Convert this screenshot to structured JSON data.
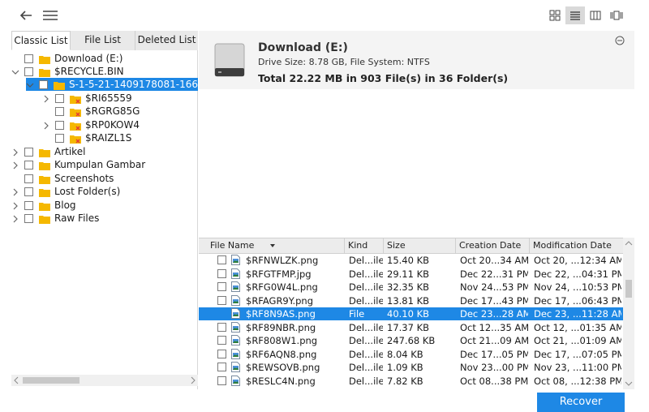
{
  "colors": {
    "accent": "#1e88e5",
    "folder": "#f5b800",
    "mark": "#e53935"
  },
  "tabs": [
    {
      "label": "Classic List"
    },
    {
      "label": "File List"
    },
    {
      "label": "Deleted List"
    }
  ],
  "tree": [
    {
      "label": "Download (E:)",
      "chevron": "",
      "icon": "folder-icon"
    },
    {
      "label": "$RECYCLE.BIN",
      "chevron": "chevron-down-icon",
      "icon": "folder-icon"
    },
    {
      "label": "S-1-5-21-1409178081-166",
      "chevron": "chevron-down-icon",
      "icon": "folder-icon",
      "selected": true
    },
    {
      "label": "$RI65559",
      "chevron": "chevron-right-icon",
      "icon": "folder-x-icon"
    },
    {
      "label": "$RGRG85G",
      "chevron": "",
      "icon": "folder-x-icon"
    },
    {
      "label": "$RP0KOW4",
      "chevron": "chevron-right-icon",
      "icon": "folder-x-icon"
    },
    {
      "label": "$RAIZL1S",
      "chevron": "",
      "icon": "folder-x-icon"
    },
    {
      "label": "Artikel",
      "chevron": "chevron-right-icon",
      "icon": "folder-icon"
    },
    {
      "label": "Kumpulan Gambar",
      "chevron": "chevron-right-icon",
      "icon": "folder-icon"
    },
    {
      "label": "Screenshots",
      "chevron": "",
      "icon": "folder-icon"
    },
    {
      "label": "Lost Folder(s)",
      "chevron": "chevron-right-icon",
      "icon": "folder-icon"
    },
    {
      "label": "Blog",
      "chevron": "chevron-right-icon",
      "icon": "folder-icon"
    },
    {
      "label": "Raw Files",
      "chevron": "chevron-right-icon",
      "icon": "folder-icon"
    }
  ],
  "header": {
    "title": "Download (E:)",
    "info": "Drive Size: 8.78 GB, File System: NTFS",
    "total": "Total 22.22 MB in 903 File(s) in 36 Folder(s)"
  },
  "columns": [
    "File Name",
    "Kind",
    "Size",
    "Creation Date",
    "Modification Date"
  ],
  "files": [
    {
      "name": "$RFNWLZK.png",
      "kind": "Del...ile",
      "size": "15.40 KB",
      "created": "Oct 20...34 AM",
      "modified": "Oct 20, ...12:34 AM"
    },
    {
      "name": "$RFGTFMP.jpg",
      "kind": "Del...ile",
      "size": "29.11 KB",
      "created": "Dec 22...31 PM",
      "modified": "Dec 22, ...04:31 PM"
    },
    {
      "name": "$RFG0W4L.png",
      "kind": "Del...ile",
      "size": "32.35 KB",
      "created": "Nov 24...53 PM",
      "modified": "Nov 24, ...10:53 PM"
    },
    {
      "name": "$RFAGR9Y.png",
      "kind": "Del...ile",
      "size": "13.81 KB",
      "created": "Dec 17...43 PM",
      "modified": "Dec 17, ...06:43 PM"
    },
    {
      "name": "$RF8N9AS.png",
      "kind": "File",
      "size": "40.10 KB",
      "created": "Dec 23...28 AM",
      "modified": "Dec 23, ...11:28 AM",
      "selected": true
    },
    {
      "name": "$RF89NBR.png",
      "kind": "Del...ile",
      "size": "17.37 KB",
      "created": "Oct 12...35 AM",
      "modified": "Oct 12, ...01:35 AM"
    },
    {
      "name": "$RF808W1.png",
      "kind": "Del...ile",
      "size": "247.68 KB",
      "created": "Oct 21...09 AM",
      "modified": "Oct 21, ...01:09 AM"
    },
    {
      "name": "$RF6AQN8.png",
      "kind": "Del...ile",
      "size": "8.04 KB",
      "created": "Dec 17...05 PM",
      "modified": "Dec 17, ...07:05 PM"
    },
    {
      "name": "$REWSOVB.png",
      "kind": "Del...ile",
      "size": "1.09 KB",
      "created": "Nov 23...00 PM",
      "modified": "Nov 23, ...11:00 PM"
    },
    {
      "name": "$RESLC4N.png",
      "kind": "Del...ile",
      "size": "7.82 KB",
      "created": "Oct 08...38 PM",
      "modified": "Oct 08, ...12:38 PM"
    }
  ],
  "recover_label": "Recover"
}
